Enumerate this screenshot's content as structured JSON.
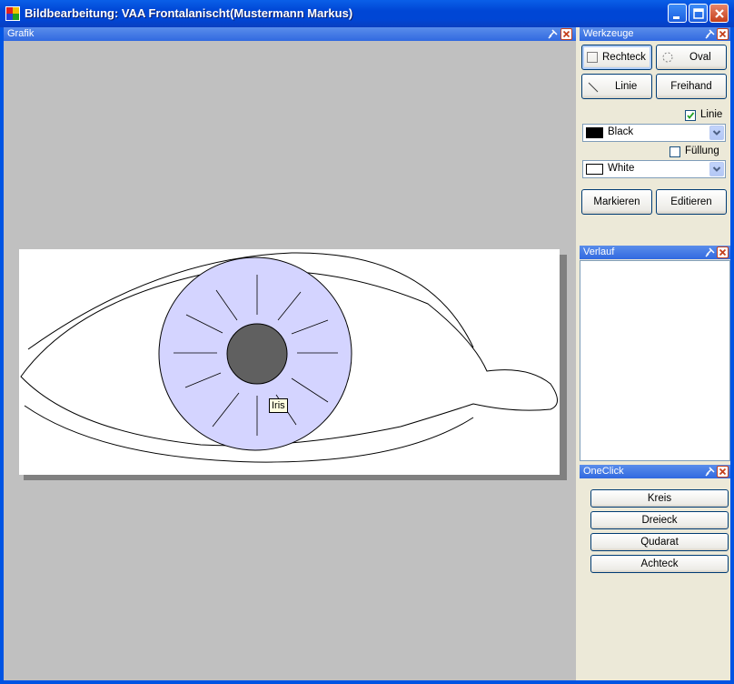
{
  "window": {
    "title": "Bildbearbeitung: VAA Frontalanischt(Mustermann Markus)"
  },
  "grafik": {
    "title": "Grafik",
    "tooltip": "Iris"
  },
  "werkzeuge": {
    "title": "Werkzeuge",
    "rechteck": "Rechteck",
    "oval": "Oval",
    "linie": "Linie",
    "freihand": "Freihand",
    "linie_check_label": "Linie",
    "linie_checked": true,
    "line_color": "Black",
    "line_color_hex": "#000000",
    "fuellung_label": "Füllung",
    "fuellung_checked": false,
    "fill_color": "White",
    "fill_color_hex": "#FFFFFF",
    "markieren": "Markieren",
    "editieren": "Editieren"
  },
  "verlauf": {
    "title": "Verlauf"
  },
  "oneclick": {
    "title": "OneClick",
    "buttons": [
      "Kreis",
      "Dreieck",
      "Qudarat",
      "Achteck"
    ]
  }
}
